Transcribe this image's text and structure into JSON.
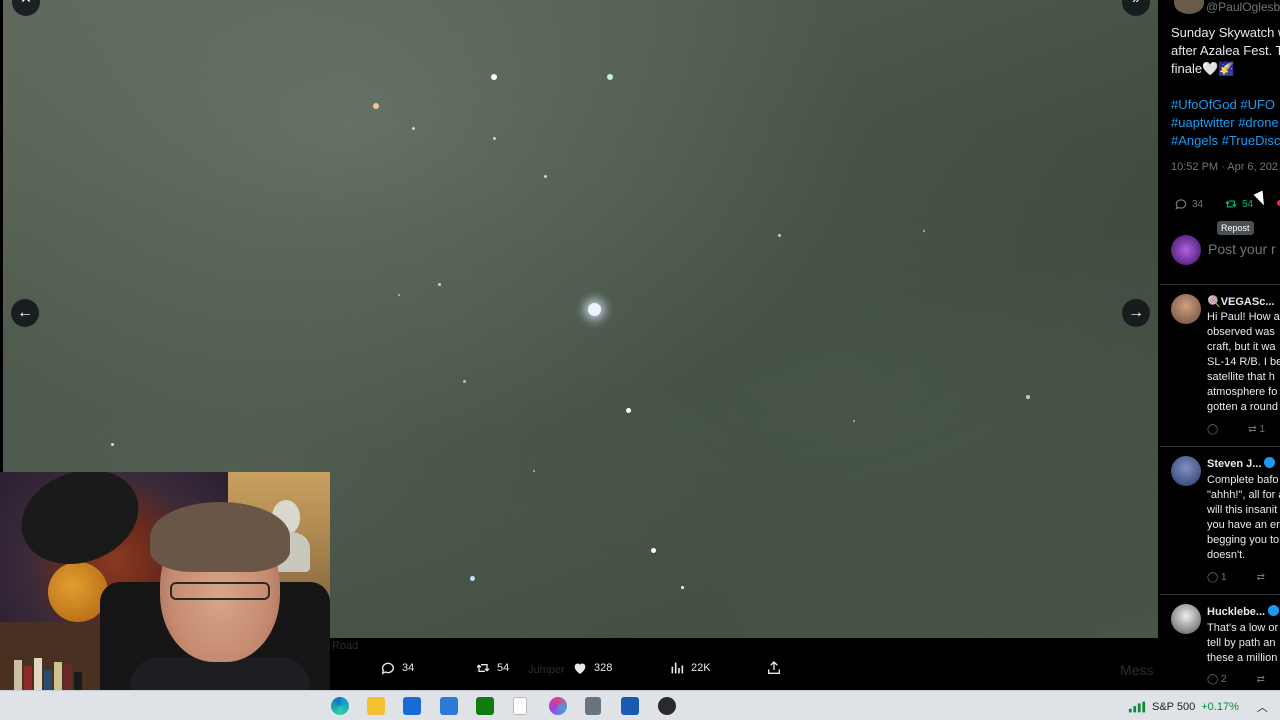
{
  "viewer": {
    "close_label": "✕",
    "expand_label": "»",
    "prev_label": "←",
    "next_label": "→",
    "actions": {
      "replies": "34",
      "reposts": "54",
      "likes": "328",
      "views": "22K"
    },
    "ghost_texts": {
      "a": "Road",
      "b": "Jumper",
      "c": "Mess"
    }
  },
  "post": {
    "handle": "@PaulOglesb",
    "text_lines": [
      "Sunday Skywatch w",
      "after Azalea Fest. T",
      "finale🤍🌠"
    ],
    "hashtag_lines": [
      "#UfoOfGod #UFO",
      "#uaptwitter #drone",
      "#Angels #TrueDisc"
    ],
    "timestamp": "10:52 PM · Apr 6, 202",
    "stats": {
      "replies": "34",
      "reposts": "54"
    },
    "tooltip": "Repost",
    "reply_placeholder": "Post your r"
  },
  "comments": [
    {
      "name": "🍭VEGASc...",
      "verified": false,
      "lines": [
        "Hi Paul! How a",
        "observed was",
        "craft, but it wa",
        "SL-14 R/B. I be",
        "satellite that h",
        "atmosphere fo",
        "gotten a round"
      ],
      "replies": "",
      "reposts": "1"
    },
    {
      "name": "Steven J...",
      "verified": true,
      "lines": [
        "Complete bafo",
        "\"ahhh!\", all for a",
        "will this insanit",
        "you have an er",
        "begging you to",
        "doesn't."
      ],
      "replies": "1",
      "reposts": ""
    },
    {
      "name": "Hucklebe...",
      "verified": true,
      "lines": [
        "That's a low or",
        "tell by path an",
        "these a million"
      ],
      "replies": "2",
      "reposts": ""
    }
  ],
  "taskbar": {
    "ticker_name": "S&P 500",
    "ticker_change": "+0.17%"
  },
  "colors": {
    "link_blue": "#1d9bf0",
    "muted_gray": "#71767b",
    "repost_green": "#00ba7c"
  }
}
